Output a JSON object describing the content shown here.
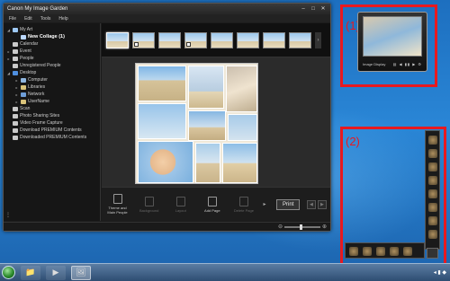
{
  "app": {
    "title": "Canon My Image Garden",
    "window_controls": [
      "–",
      "□",
      "✕"
    ]
  },
  "menu": [
    "File",
    "Edit",
    "Tools",
    "Help"
  ],
  "sidebar": {
    "items": [
      {
        "label": "My Art",
        "indent": 0,
        "arrow": "◢",
        "icon_color": "#9ec9f5"
      },
      {
        "label": "New Collage (1)",
        "indent": 1,
        "arrow": "",
        "icon_color": "#bcd8ff",
        "selected": true
      },
      {
        "label": "Calendar",
        "indent": 0,
        "arrow": "",
        "icon_color": "#c9c9c9"
      },
      {
        "label": "Event",
        "indent": 0,
        "arrow": "▸",
        "icon_color": "#c9c9c9"
      },
      {
        "label": "People",
        "indent": 0,
        "arrow": "▸",
        "icon_color": "#c9c9c9"
      },
      {
        "label": "Unregistered People",
        "indent": 0,
        "arrow": "",
        "icon_color": "#c9c9c9"
      },
      {
        "label": "Desktop",
        "indent": 0,
        "arrow": "◢",
        "icon_color": "#4f8fe0"
      },
      {
        "label": "Computer",
        "indent": 1,
        "arrow": "▸",
        "icon_color": "#8fb6df"
      },
      {
        "label": "Libraries",
        "indent": 1,
        "arrow": "▸",
        "icon_color": "#d9c37a"
      },
      {
        "label": "Network",
        "indent": 1,
        "arrow": "▸",
        "icon_color": "#6e9ed8"
      },
      {
        "label": "UserName",
        "indent": 1,
        "arrow": "▸",
        "icon_color": "#d9c37a"
      },
      {
        "label": "Scan",
        "indent": 0,
        "arrow": "",
        "icon_color": "#c9c9c9"
      },
      {
        "label": "Photo Sharing Sites",
        "indent": 0,
        "arrow": "",
        "icon_color": "#c9c9c9"
      },
      {
        "label": "Video Frame Capture",
        "indent": 0,
        "arrow": "",
        "icon_color": "#c9c9c9"
      },
      {
        "label": "Download PREMIUM Contents",
        "indent": 0,
        "arrow": "",
        "icon_color": "#c9c9c9"
      },
      {
        "label": "Downloaded PREMIUM Contents",
        "indent": 0,
        "arrow": "",
        "icon_color": "#c9c9c9"
      }
    ],
    "footer": "⋮"
  },
  "toolbar": {
    "tools": [
      {
        "label": "Theme and Main People",
        "enabled": true
      },
      {
        "label": "Background",
        "enabled": false
      },
      {
        "label": "Layout",
        "enabled": false
      },
      {
        "label": "Add Page",
        "enabled": true
      },
      {
        "label": "Delete Page",
        "enabled": false
      }
    ],
    "more": "▸",
    "print_label": "Print",
    "nav_prev": "◀",
    "nav_next": "▶"
  },
  "zoom": {
    "minus": "⊖",
    "plus": "⊕",
    "level": 0.45
  },
  "callouts": [
    {
      "label": "(1)"
    },
    {
      "label": "(2)"
    }
  ],
  "gadget": {
    "label": "Image Display",
    "controls": "▤ ◀ ▮▮ ▶ ⚙"
  },
  "taskbar": {
    "apps": [
      "📁",
      "▶",
      "🖼"
    ],
    "tray": "◂ ▮ ◆"
  }
}
